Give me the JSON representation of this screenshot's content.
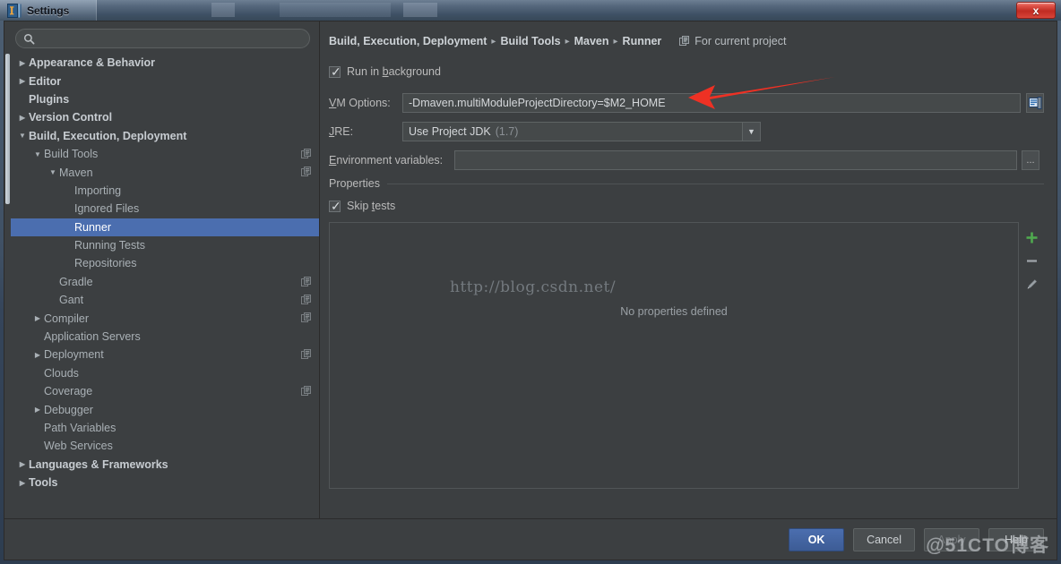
{
  "window": {
    "title": "Settings",
    "app_icon": "intellij-idea-logo-icon",
    "close_label": "x"
  },
  "search": {
    "value": "",
    "placeholder": "",
    "icon": "search-icon"
  },
  "sidebar": {
    "items": [
      {
        "label": "Appearance & Behavior",
        "level": 0,
        "twisty": "collapsed",
        "top": true,
        "selected": false,
        "scope_icon": false
      },
      {
        "label": "Editor",
        "level": 0,
        "twisty": "collapsed",
        "top": true,
        "selected": false,
        "scope_icon": false
      },
      {
        "label": "Plugins",
        "level": 0,
        "twisty": "none",
        "top": true,
        "selected": false,
        "scope_icon": false
      },
      {
        "label": "Version Control",
        "level": 0,
        "twisty": "collapsed",
        "top": true,
        "selected": false,
        "scope_icon": false
      },
      {
        "label": "Build, Execution, Deployment",
        "level": 0,
        "twisty": "expanded",
        "top": true,
        "selected": false,
        "scope_icon": false
      },
      {
        "label": "Build Tools",
        "level": 1,
        "twisty": "expanded",
        "top": false,
        "selected": false,
        "scope_icon": true
      },
      {
        "label": "Maven",
        "level": 2,
        "twisty": "expanded",
        "top": false,
        "selected": false,
        "scope_icon": true
      },
      {
        "label": "Importing",
        "level": 3,
        "twisty": "none",
        "top": false,
        "selected": false,
        "scope_icon": false
      },
      {
        "label": "Ignored Files",
        "level": 3,
        "twisty": "none",
        "top": false,
        "selected": false,
        "scope_icon": false
      },
      {
        "label": "Runner",
        "level": 3,
        "twisty": "none",
        "top": false,
        "selected": true,
        "scope_icon": false
      },
      {
        "label": "Running Tests",
        "level": 3,
        "twisty": "none",
        "top": false,
        "selected": false,
        "scope_icon": false
      },
      {
        "label": "Repositories",
        "level": 3,
        "twisty": "none",
        "top": false,
        "selected": false,
        "scope_icon": false
      },
      {
        "label": "Gradle",
        "level": 2,
        "twisty": "none",
        "top": false,
        "selected": false,
        "scope_icon": true
      },
      {
        "label": "Gant",
        "level": 2,
        "twisty": "none",
        "top": false,
        "selected": false,
        "scope_icon": true
      },
      {
        "label": "Compiler",
        "level": 1,
        "twisty": "collapsed",
        "top": false,
        "selected": false,
        "scope_icon": true
      },
      {
        "label": "Application Servers",
        "level": 1,
        "twisty": "none",
        "top": false,
        "selected": false,
        "scope_icon": false
      },
      {
        "label": "Deployment",
        "level": 1,
        "twisty": "collapsed",
        "top": false,
        "selected": false,
        "scope_icon": true
      },
      {
        "label": "Clouds",
        "level": 1,
        "twisty": "none",
        "top": false,
        "selected": false,
        "scope_icon": false
      },
      {
        "label": "Coverage",
        "level": 1,
        "twisty": "none",
        "top": false,
        "selected": false,
        "scope_icon": true
      },
      {
        "label": "Debugger",
        "level": 1,
        "twisty": "collapsed",
        "top": false,
        "selected": false,
        "scope_icon": false
      },
      {
        "label": "Path Variables",
        "level": 1,
        "twisty": "none",
        "top": false,
        "selected": false,
        "scope_icon": false
      },
      {
        "label": "Web Services",
        "level": 1,
        "twisty": "none",
        "top": false,
        "selected": false,
        "scope_icon": false
      },
      {
        "label": "Languages & Frameworks",
        "level": 0,
        "twisty": "collapsed",
        "top": true,
        "selected": false,
        "scope_icon": false
      },
      {
        "label": "Tools",
        "level": 0,
        "twisty": "collapsed",
        "top": true,
        "selected": false,
        "scope_icon": false
      }
    ]
  },
  "main": {
    "breadcrumb": [
      "Build, Execution, Deployment",
      "Build Tools",
      "Maven",
      "Runner"
    ],
    "breadcrumb_separator": "▸",
    "scope": {
      "icon": "project-scope-icon",
      "label": "For current project"
    },
    "run_in_background": {
      "label_before": "Run in ",
      "label_mnemonic": "b",
      "label_after": "ackground",
      "checked": true
    },
    "vm_options": {
      "label_mnemonic": "V",
      "label_rest": "M Options:",
      "value": "-Dmaven.multiModuleProjectDirectory=$M2_HOME",
      "expand_icon": "expand-editor-icon"
    },
    "jre": {
      "label_mnemonic": "J",
      "label_rest": "RE:",
      "value": "Use Project JDK",
      "value_suffix": "(1.7)",
      "arrow_icon": "chevron-down-icon"
    },
    "environment_variables": {
      "label_mnemonic": "E",
      "label_rest": "nvironment variables:",
      "value": "",
      "browse_label": "..."
    },
    "properties_group": {
      "title": "Properties",
      "skip_tests": {
        "label_before": "Skip ",
        "label_mnemonic": "t",
        "label_after": "ests",
        "checked": true
      },
      "empty_message": "No properties defined",
      "toolbar": [
        {
          "name": "add-property-icon",
          "glyph": "+"
        },
        {
          "name": "remove-property-icon",
          "glyph": "–"
        },
        {
          "name": "edit-property-icon",
          "glyph": "pencil"
        }
      ]
    }
  },
  "footer": {
    "ok": "OK",
    "cancel": "Cancel",
    "apply": "Apply",
    "help": "Help"
  },
  "watermarks": {
    "url": "http://blog.csdn.net/",
    "site": "@51CTO博客"
  },
  "colors": {
    "panel_bg": "#3c3f41",
    "field_bg": "#45494a",
    "selection_blue": "#4b6eaf",
    "text_primary": "#bbbbbb",
    "text_bold": "#cdd2d6",
    "text_muted": "#8b9095",
    "close_red": "#c02b22",
    "add_green": "#4fa84f",
    "arrow_red": "#ee3124"
  }
}
